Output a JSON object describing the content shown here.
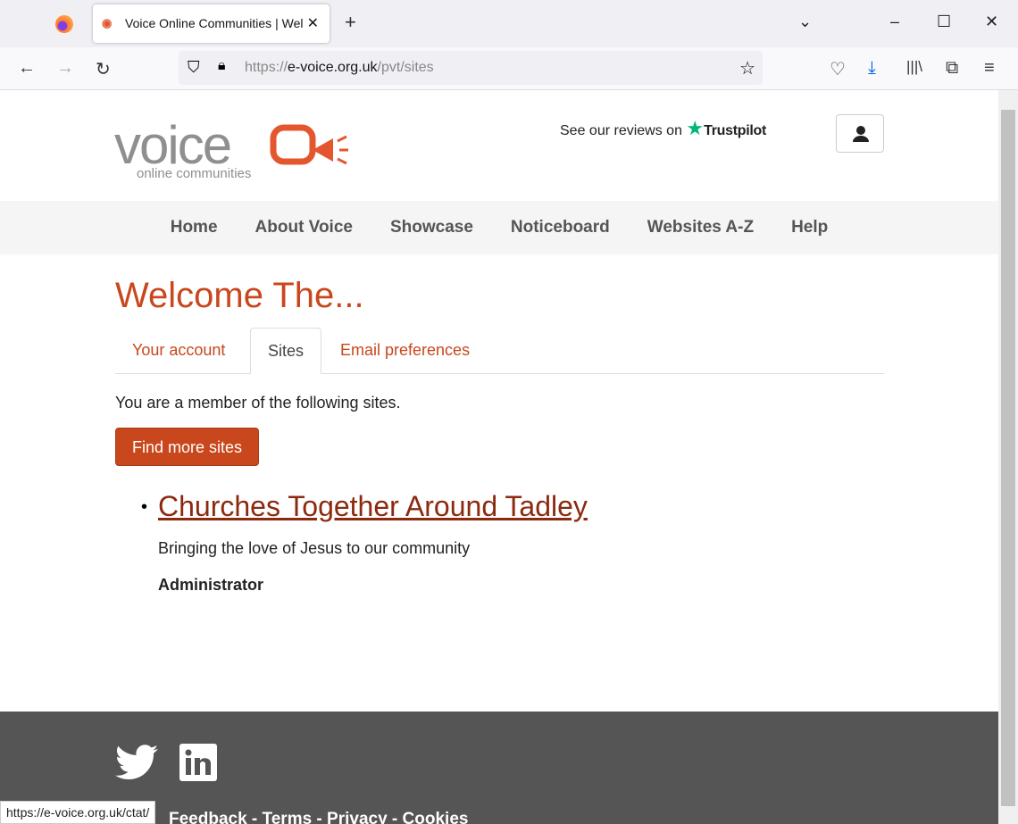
{
  "browser": {
    "tab_title": "Voice Online Communities | Welcome",
    "url_prefix": "https://",
    "url_domain": "e-voice.org.uk",
    "url_path": "/pvt/sites",
    "status_url": "https://e-voice.org.uk/ctat/"
  },
  "header": {
    "logo_text": "voice",
    "logo_sub": "online communities",
    "trust_prefix": "See our reviews on",
    "trust_brand": "Trustpilot"
  },
  "menu": [
    {
      "label": "Home"
    },
    {
      "label": "About Voice"
    },
    {
      "label": "Showcase"
    },
    {
      "label": "Noticeboard"
    },
    {
      "label": "Websites A-Z"
    },
    {
      "label": "Help"
    }
  ],
  "main": {
    "title": "Welcome The...",
    "tabs": [
      {
        "label": "Your account"
      },
      {
        "label": "Sites"
      },
      {
        "label": "Email preferences"
      }
    ],
    "intro": "You are a member of the following sites.",
    "find_button": "Find more sites",
    "sites": [
      {
        "name": "Churches Together Around Tadley",
        "description": "Bringing the love of Jesus to our community",
        "role": "Administrator"
      }
    ]
  },
  "footer": {
    "links": "Feedback - Terms - Privacy - Cookies"
  },
  "colors": {
    "accent": "#c9471c",
    "footer": "#555555"
  }
}
